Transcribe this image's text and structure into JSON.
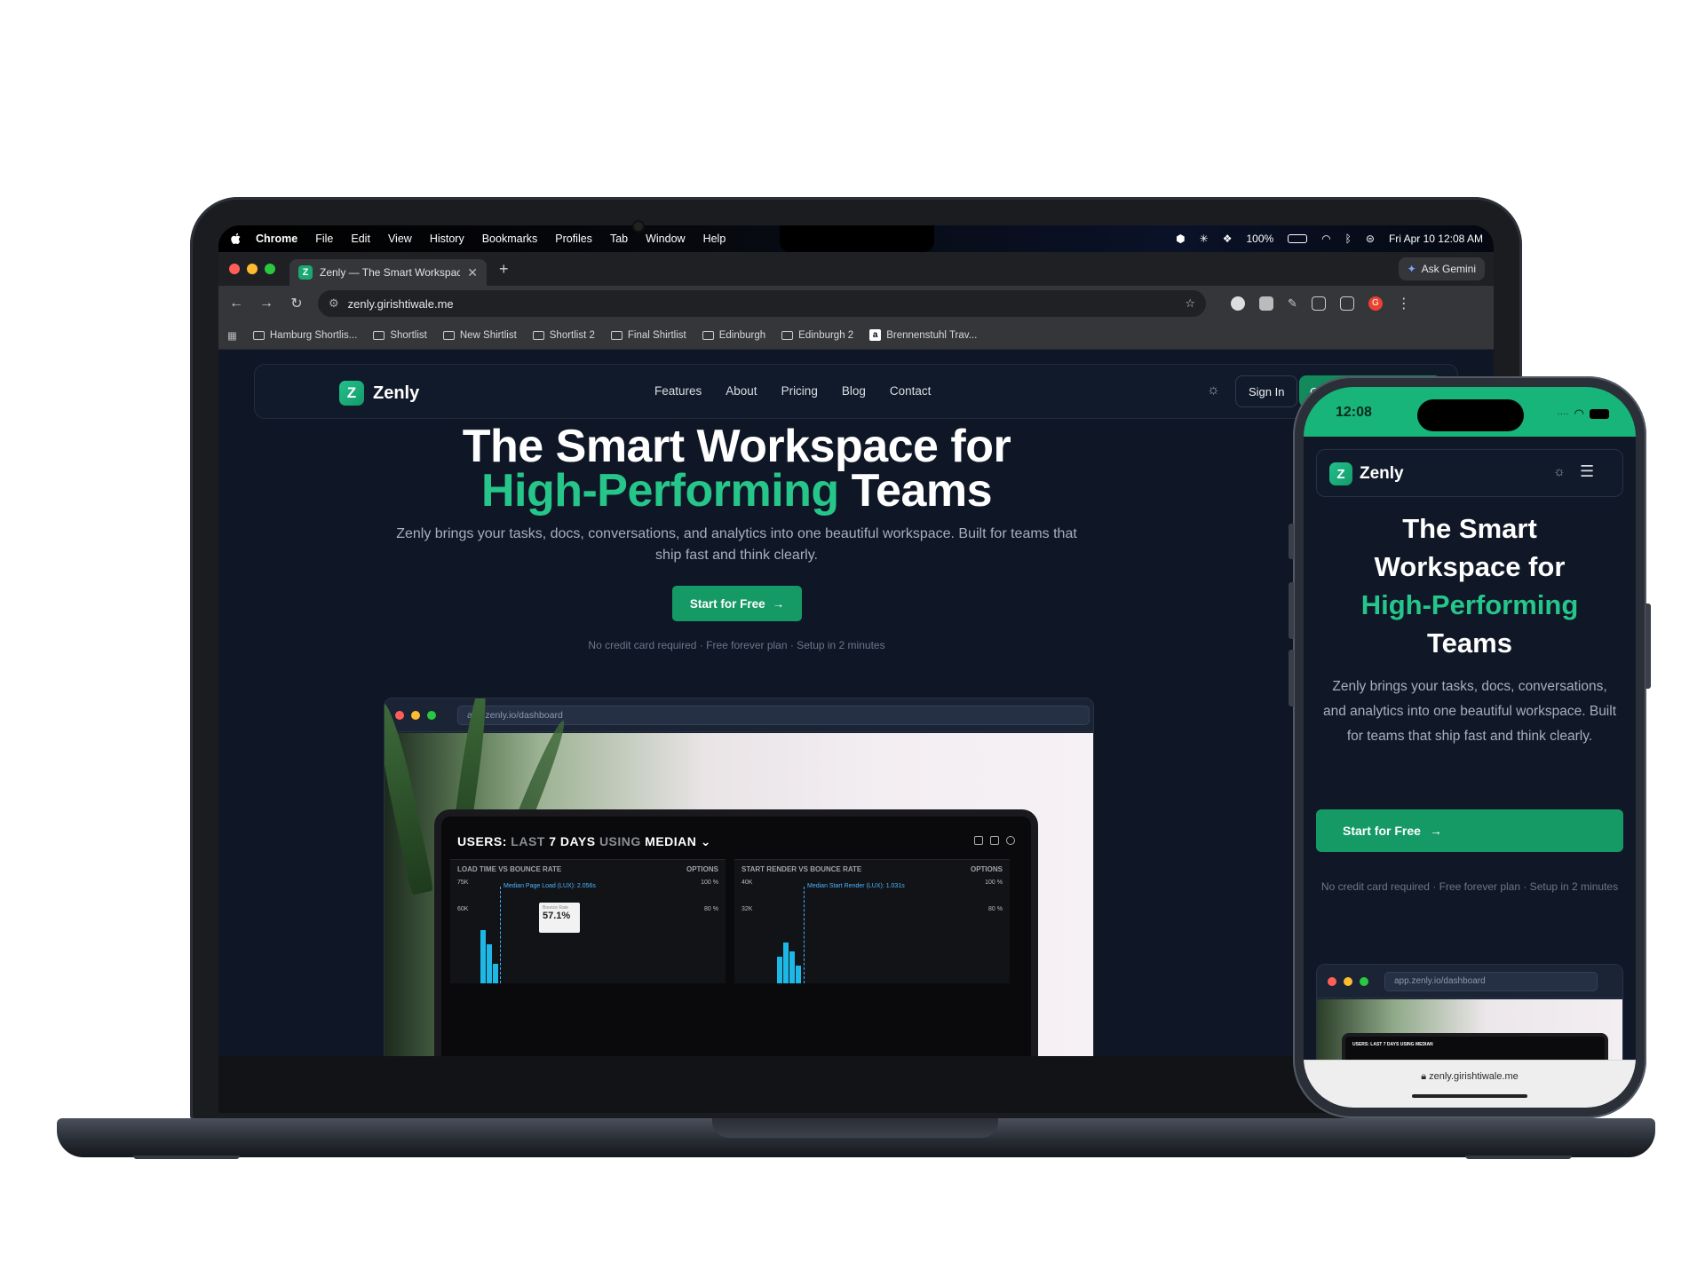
{
  "menubar": {
    "app": "Chrome",
    "items": [
      "File",
      "Edit",
      "View",
      "History",
      "Bookmarks",
      "Profiles",
      "Tab",
      "Window",
      "Help"
    ],
    "battery": "100%",
    "datetime": "Fri Apr 10  12:08 AM"
  },
  "browser": {
    "tab_title": "Zenly — The Smart Workspac",
    "ask_gemini": "Ask Gemini",
    "url": "zenly.girishtiwale.me",
    "bookmarks": [
      "Hamburg Shortlis...",
      "Shortlist",
      "New Shirtlist",
      "Shortlist 2",
      "Final Shirtlist",
      "Edinburgh",
      "Edinburgh 2",
      "Brennenstuhl Trav..."
    ],
    "profile_initial": "G"
  },
  "site": {
    "brand": "Zenly",
    "logo_letter": "Z",
    "nav": [
      "Features",
      "About",
      "Pricing",
      "Blog",
      "Contact"
    ],
    "sign_in": "Sign In",
    "get_started_partial": "G",
    "hero_line1": "The Smart Workspace for",
    "hero_highlight": "High-Performing",
    "hero_line2_rest": "Teams",
    "subtitle": "Zenly brings your tasks, docs, conversations, and analytics into one beautiful workspace. Built for teams that ship fast and think clearly.",
    "cta": "Start for Free",
    "fineprint": "No credit card required · Free forever plan · Setup in 2 minutes",
    "mock_url": "app.zenly.io/dashboard"
  },
  "dashboard_image": {
    "title_bold": "USERS:",
    "title_dim": "LAST",
    "title_bold2": "7 DAYS",
    "title_dim2": "USING",
    "title_bold3": "MEDIAN",
    "panel1_title": "LOAD TIME VS BOUNCE RATE",
    "panel1_annotation": "Median Page Load (LUX): 2.056s",
    "panel2_title": "START RENDER VS BOUNCE RATE",
    "panel2_annotation": "Median Start Render (LUX): 1.031s",
    "options": "OPTIONS",
    "y1_top": "75K",
    "y1_mid": "60K",
    "y2_top": "40K",
    "y2_mid": "32K",
    "r_top": "100 %",
    "r_mid": "80 %",
    "tooltip_label": "Bounce Rate",
    "tooltip_value": "57.1%"
  },
  "phone": {
    "time": "12:08",
    "url": "zenly.girishtiwale.me",
    "title_l1": "The Smart",
    "title_l2": "Workspace for",
    "title_l3": "High-Performing",
    "title_l4": "Teams",
    "subtitle": "Zenly brings your tasks, docs, conversations, and analytics into one beautiful workspace. Built for teams that ship fast and think clearly.",
    "fineprint": "No credit card required · Free forever plan · Setup in 2 minutes",
    "mock_title": "USERS: LAST 7 DAYS USING MEDIAN"
  },
  "colors": {
    "accent": "#26c68a",
    "button": "#159a66",
    "page_bg": "#0f1727",
    "phone_status": "#17b57a"
  },
  "icons": [
    "apple-icon",
    "star-icon",
    "reload-icon",
    "back-icon",
    "forward-icon",
    "sun-icon",
    "menu-icon",
    "arrow-right-icon",
    "wifi-icon",
    "battery-icon",
    "folder-icon",
    "gemini-sparkle-icon"
  ]
}
